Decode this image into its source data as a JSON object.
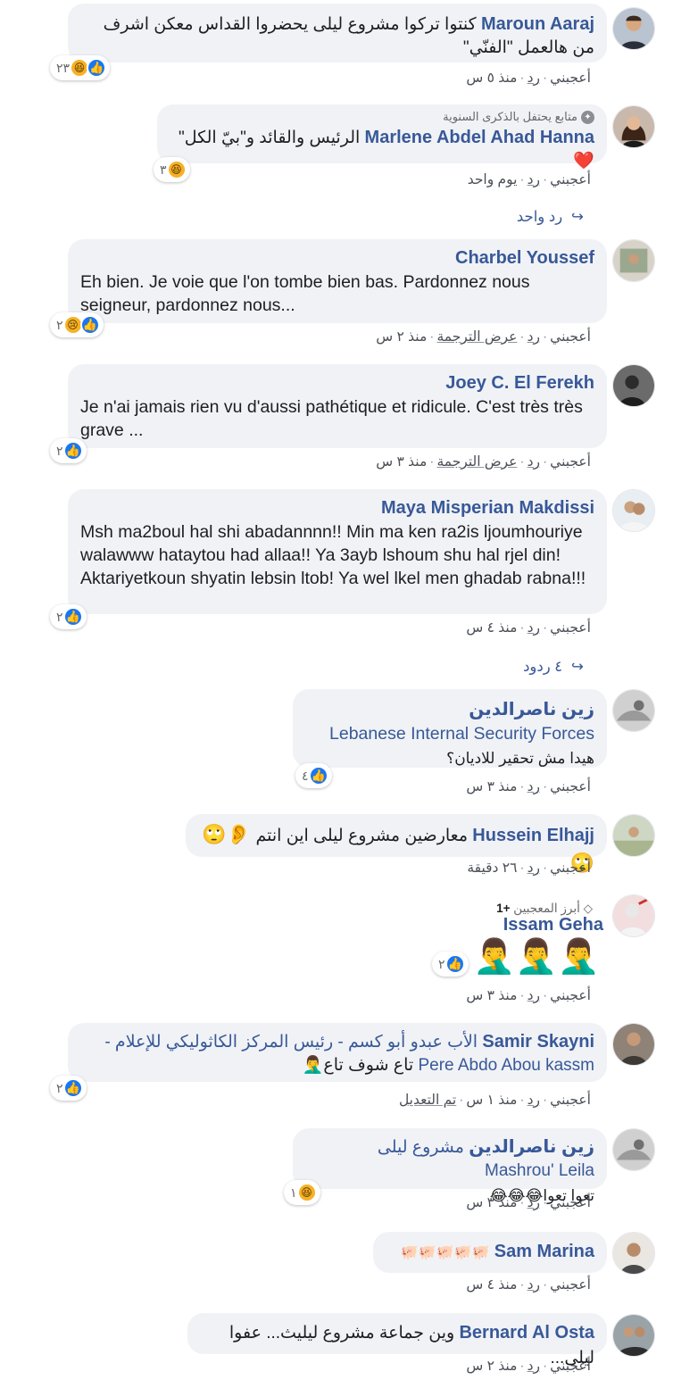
{
  "comments": [
    {
      "author": "Maroun Aaraj",
      "text": "كنتوا تركوا مشروع ليلى يحضروا القداس معكن اشرف من هالعمل \"الفنّي\"",
      "reactions": {
        "count": "٢٣",
        "types": [
          "like",
          "haha"
        ]
      },
      "actions": {
        "like": "أعجبني",
        "reply": "رد",
        "time": "منذ ٥ س"
      }
    },
    {
      "badge": "متابع يحتفل بالذكرى السنوية",
      "author": "Marlene Abdel Ahad Hanna",
      "text": "الرئيس والقائد و\"بيّ الكل\"",
      "reactions": {
        "count": "٣",
        "types": [
          "haha"
        ]
      },
      "actions": {
        "like": "أعجبني",
        "reply": "رد",
        "time": "يوم واحد"
      },
      "replies_link": "رد واحد"
    },
    {
      "author": "Charbel Youssef",
      "text": "Eh bien. Je voie que l'on tombe bien bas. Pardonnez nous seigneur, pardonnez nous...",
      "reactions": {
        "count": "٢",
        "types": [
          "like",
          "sad"
        ]
      },
      "actions": {
        "like": "أعجبني",
        "reply": "رد",
        "translate": "عرض الترجمة",
        "time": "منذ ٢ س"
      }
    },
    {
      "author": "Joey C. El Ferekh",
      "text": "Je n'ai jamais rien vu d'aussi pathétique et ridicule. C'est très très grave ...",
      "reactions": {
        "count": "٢",
        "types": [
          "like"
        ]
      },
      "actions": {
        "like": "أعجبني",
        "reply": "رد",
        "translate": "عرض الترجمة",
        "time": "منذ ٣ س"
      }
    },
    {
      "author": "Maya Misperian Makdissi",
      "text": "Msh ma2boul hal shi abadannnn!! Min ma ken ra2is ljoumhouriye walawww hataytou had allaa!! Ya 3ayb lshoum shu hal rjel din! Aktariyetkoun shyatin lebsin ltob! Ya wel lkel men ghadab rabna!!!",
      "reactions": {
        "count": "٢",
        "types": [
          "like"
        ]
      },
      "actions": {
        "like": "أعجبني",
        "reply": "رد",
        "time": "منذ ٤ س"
      },
      "replies_link": "٤ ردود"
    },
    {
      "author": "زين ناصرالدين",
      "mention": "Lebanese Internal Security Forces",
      "text": "هيدا مش تحقير للاديان؟",
      "reactions": {
        "count": "٤",
        "types": [
          "like"
        ]
      },
      "actions": {
        "like": "أعجبني",
        "reply": "رد",
        "time": "منذ ٣ س"
      }
    },
    {
      "author": "Hussein Elhajj",
      "text": "معارضين مشروع ليلى اين انتم",
      "emojis": "👂🙄🙄",
      "actions": {
        "like": "أعجبني",
        "reply": "رد",
        "time": "٢٦ دقيقة"
      }
    },
    {
      "top_fan": "أبرز المعجبين",
      "top_fan_plus": "+1",
      "author": "Issam Geha",
      "emojis": "🤦‍♂️🤦‍♂️🤦‍♂️",
      "reactions": {
        "count": "٢",
        "types": [
          "like"
        ]
      },
      "actions": {
        "like": "أعجبني",
        "reply": "رد",
        "time": "منذ ٣ س"
      }
    },
    {
      "author": "Samir Skayni",
      "mention": "الأب عبدو أبو كسم - رئيس المركز الكاثوليكي للإعلام - Pere Abdo Abou kassm",
      "text": "تاع شوف تاع🤦‍♂️",
      "reactions": {
        "count": "٢",
        "types": [
          "like"
        ]
      },
      "actions": {
        "like": "أعجبني",
        "reply": "رد",
        "time": "منذ ١ س",
        "edited": "تم التعديل"
      }
    },
    {
      "author": "زين ناصرالدين",
      "mention": "مشروع ليلى Mashrou' Leila",
      "text": "تعوا تعوا😂😂😂",
      "reactions": {
        "count": "١",
        "types": [
          "haha"
        ]
      },
      "actions": {
        "like": "أعجبني",
        "reply": "رد",
        "time": "منذ ٣ س"
      }
    },
    {
      "author": "Sam Marina",
      "emojis": "🐖🐖🐖🐖🐖",
      "actions": {
        "like": "أعجبني",
        "reply": "رد",
        "time": "منذ ٤ س"
      }
    },
    {
      "author": "Bernard Al Osta",
      "text": "وين جماعة مشروع ليليث... عفوا ليلى...",
      "actions": {
        "like": "أعجبني",
        "reply": "رد",
        "time": "منذ ٢ س"
      }
    }
  ],
  "colors": {
    "link": "#385898",
    "bubble": "#f0f2f5",
    "like": "#1877f2",
    "haha": "#f7b125",
    "heart": "#e0245e"
  }
}
